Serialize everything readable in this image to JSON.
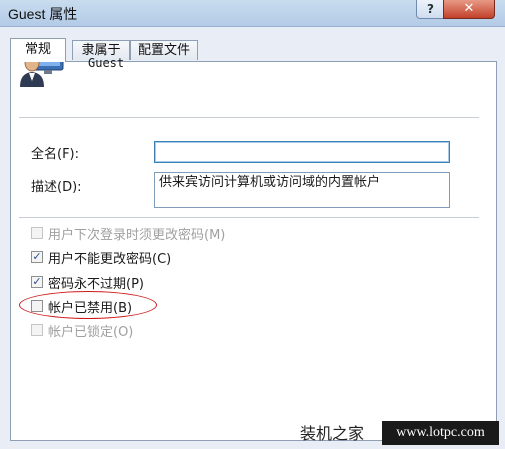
{
  "window": {
    "title": "Guest 属性",
    "help_label": "?",
    "close_label": "✕"
  },
  "tabs": [
    {
      "label": "常规",
      "active": true
    },
    {
      "label": "隶属于",
      "active": false
    },
    {
      "label": "配置文件",
      "active": false
    }
  ],
  "user": {
    "icon": "user-avatar-icon",
    "name": "Guest"
  },
  "fields": {
    "full_name_label": "全名(F):",
    "full_name_value": "",
    "description_label": "描述(D):",
    "description_value": "供来宾访问计算机或访问域的内置帐户"
  },
  "checkboxes": [
    {
      "label": "用户下次登录时须更改密码(M)",
      "checked": false,
      "enabled": false
    },
    {
      "label": "用户不能更改密码(C)",
      "checked": true,
      "enabled": true
    },
    {
      "label": "密码永不过期(P)",
      "checked": true,
      "enabled": true
    },
    {
      "label": "帐户已禁用(B)",
      "checked": false,
      "enabled": true
    },
    {
      "label": "帐户已锁定(O)",
      "checked": false,
      "enabled": false
    }
  ],
  "watermark": {
    "text": "装机之家",
    "url": "www.lotpc.com"
  },
  "colors": {
    "highlight_oval": "#d01818",
    "check_mark": "#2a4f8e"
  }
}
